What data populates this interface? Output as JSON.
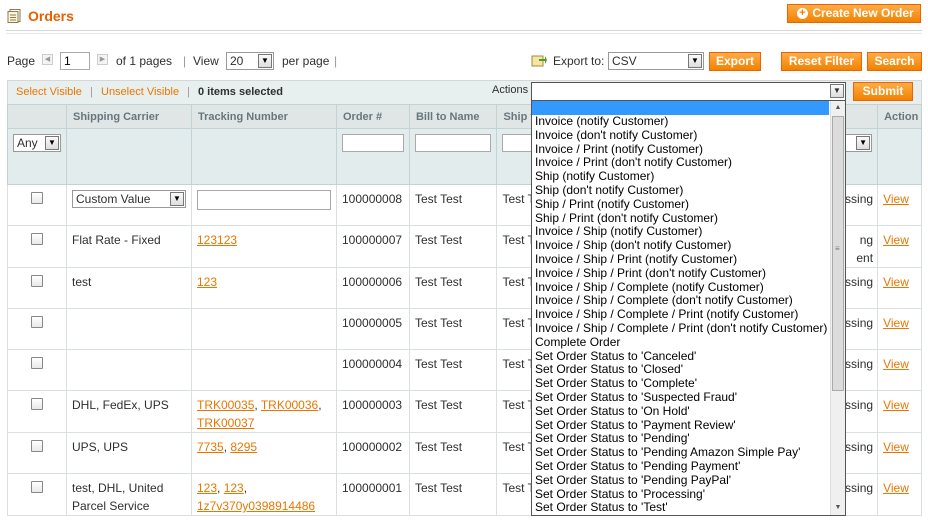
{
  "header": {
    "title": "Orders",
    "create_button": "Create New Order"
  },
  "pager": {
    "page_label": "Page",
    "page_value": "1",
    "of_pages": "of 1 pages",
    "view_label": "View",
    "view_value": "20",
    "per_page": "per page",
    "divider": "|",
    "export_label": "Export to:",
    "export_format": "CSV",
    "export_button": "Export",
    "reset_button": "Reset Filter",
    "search_button": "Search"
  },
  "massaction": {
    "select_visible": "Select Visible",
    "unselect_visible": "Unselect Visible",
    "separator": "|",
    "selected_count": "0 items selected",
    "actions_label": "Actions",
    "submit_button": "Submit",
    "options": [
      "Invoice (notify Customer)",
      "Invoice (don't notify Customer)",
      "Invoice / Print (notify Customer)",
      "Invoice / Print (don't notify Customer)",
      "Ship (notify Customer)",
      "Ship (don't notify Customer)",
      "Ship / Print (notify Customer)",
      "Ship / Print (don't notify Customer)",
      "Invoice / Ship (notify Customer)",
      "Invoice / Ship (don't notify Customer)",
      "Invoice / Ship / Print (notify Customer)",
      "Invoice / Ship / Print (don't notify Customer)",
      "Invoice / Ship / Complete (notify Customer)",
      "Invoice / Ship / Complete (don't notify Customer)",
      "Invoice / Ship / Complete / Print (notify Customer)",
      "Invoice / Ship / Complete / Print (don't notify Customer)",
      "Complete Order",
      "Set Order Status to 'Canceled'",
      "Set Order Status to 'Closed'",
      "Set Order Status to 'Complete'",
      "Set Order Status to 'Suspected Fraud'",
      "Set Order Status to 'On Hold'",
      "Set Order Status to 'Payment Review'",
      "Set Order Status to 'Pending'",
      "Set Order Status to 'Pending Amazon Simple Pay'",
      "Set Order Status to 'Pending Payment'",
      "Set Order Status to 'Pending PayPal'",
      "Set Order Status to 'Processing'",
      "Set Order Status to 'Test'"
    ]
  },
  "grid": {
    "columns": {
      "carrier": "Shipping Carrier",
      "tracking": "Tracking Number",
      "order": "Order #",
      "bill": "Bill to Name",
      "ship": "Ship to",
      "action": "Action"
    },
    "filter_any": "Any",
    "rows": [
      {
        "carrier": "Custom Value",
        "tracking": [],
        "order": "100000008",
        "bill": "Test Test",
        "ship": "Test Te",
        "status_tail": "ssing",
        "action": "View"
      },
      {
        "carrier": "Flat Rate - Fixed",
        "tracking": [
          "123123"
        ],
        "order": "100000007",
        "bill": "Test Test",
        "ship": "Test Te",
        "status_tail": "ng",
        "status_tail2": "ent",
        "action": "View"
      },
      {
        "carrier": "test",
        "tracking": [
          "123"
        ],
        "order": "100000006",
        "bill": "Test Test",
        "ship": "Test Te",
        "status_tail": "ssing",
        "action": "View"
      },
      {
        "carrier": "",
        "tracking": [],
        "order": "100000005",
        "bill": "Test Test",
        "ship": "Test Te",
        "status_tail": "ssing",
        "action": "View"
      },
      {
        "carrier": "",
        "tracking": [],
        "order": "100000004",
        "bill": "Test Test",
        "ship": "Test Te",
        "status_tail": "ssing",
        "action": "View"
      },
      {
        "carrier": "DHL, FedEx, UPS",
        "tracking": [
          "TRK00035",
          "TRK00036",
          "TRK00037"
        ],
        "order": "100000003",
        "bill": "Test Test",
        "ship": "Test Te",
        "status_tail": "ssing",
        "action": "View"
      },
      {
        "carrier": "UPS, UPS",
        "tracking": [
          "7735",
          "8295"
        ],
        "order": "100000002",
        "bill": "Test Test",
        "ship": "Test Te",
        "status_tail": "ssing",
        "action": "View"
      },
      {
        "carrier": "test, DHL, United Parcel Service",
        "tracking": [
          "123",
          "123",
          "1z7v370y0398914486"
        ],
        "order": "100000001",
        "bill": "Test Test",
        "ship": "Test Te",
        "status_tail": "ssing",
        "action": "View"
      }
    ]
  },
  "colors": {
    "accent": "#eb5e00",
    "button": "#f18200",
    "highlight": "#3399ff"
  },
  "icons": {
    "title": "document-icon",
    "export": "export-icon",
    "create": "plus-icon"
  }
}
